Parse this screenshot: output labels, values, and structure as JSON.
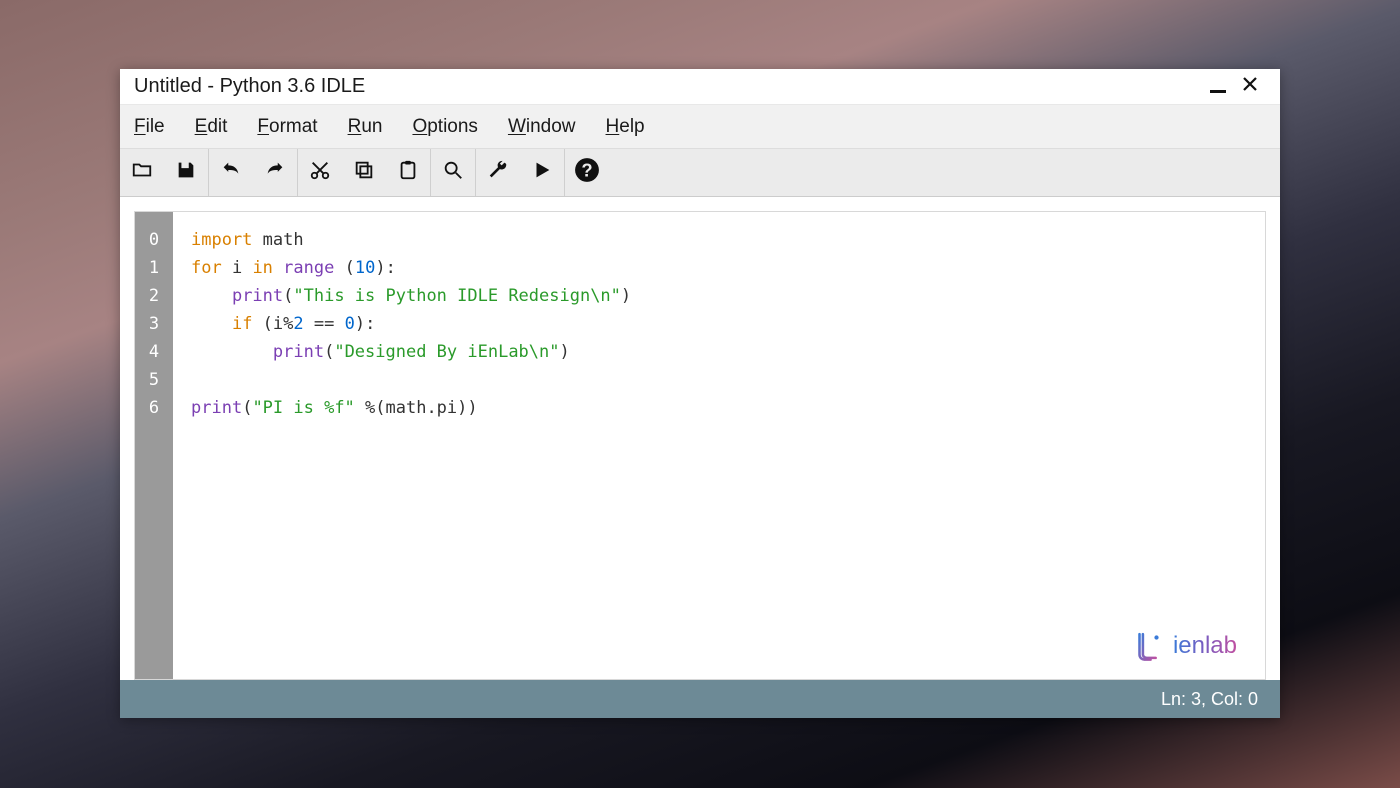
{
  "title": "Untitled - Python 3.6 IDLE",
  "menu": {
    "file": {
      "hot": "F",
      "rest": "ile"
    },
    "edit": {
      "hot": "E",
      "rest": "dit"
    },
    "format": {
      "hot": "F",
      "rest": "ormat"
    },
    "run": {
      "hot": "R",
      "rest": "un"
    },
    "options": {
      "hot": "O",
      "rest": "ptions"
    },
    "window": {
      "hot": "W",
      "rest": "indow"
    },
    "help": {
      "hot": "H",
      "rest": "elp"
    }
  },
  "gutter": [
    "0",
    "1",
    "2",
    "3",
    "4",
    "5",
    "6"
  ],
  "code": {
    "l0": {
      "kw1": "import",
      "t1": " math"
    },
    "l1": {
      "kw1": "for",
      "t1": " i ",
      "kw2": "in",
      "t2": " ",
      "fn": "range",
      "t3": " (",
      "num": "10",
      "t4": "):"
    },
    "l2": {
      "indent": "    ",
      "fn": "print",
      "t1": "(",
      "str": "\"This is Python IDLE Redesign\\n\"",
      "t2": ")"
    },
    "l3": {
      "indent": "    ",
      "kw1": "if",
      "t1": " (i%",
      "num": "2",
      "t2": " == ",
      "num2": "0",
      "t3": "):"
    },
    "l4": {
      "indent": "        ",
      "fn": "print",
      "t1": "(",
      "str": "\"Designed By iEnLab\\n\"",
      "t2": ")"
    },
    "l5": {
      "indent": ""
    },
    "l6": {
      "fn": "print",
      "t1": "(",
      "str": "\"PI is %f\"",
      "t2": " %(math.pi))"
    }
  },
  "watermark": "ienlab",
  "status": "Ln: 3, Col: 0"
}
